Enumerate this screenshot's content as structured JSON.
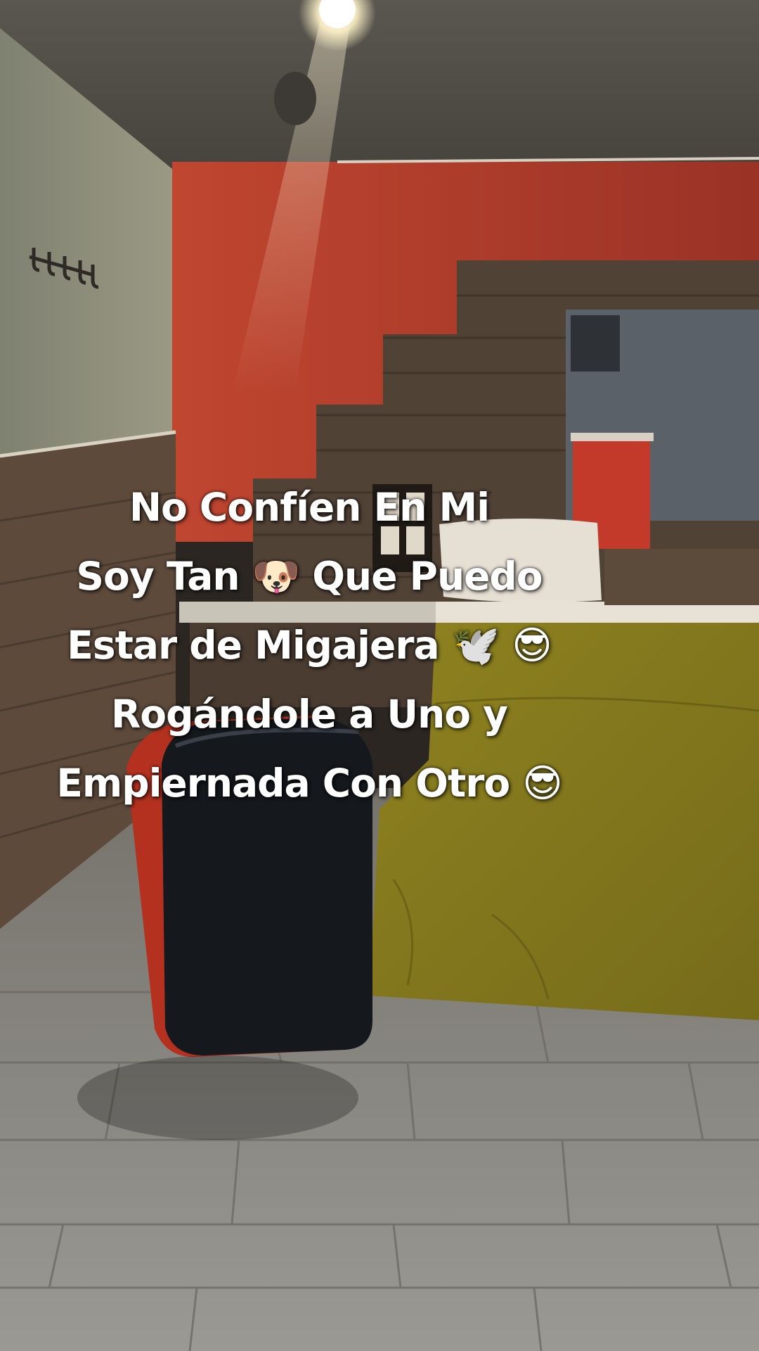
{
  "caption": {
    "lines": [
      "No Confíen En Mi",
      "Soy Tan 🐶 Que Puedo",
      "Estar de Migajera 🕊️ 😎",
      "Rogándole a Uno y",
      "Empiernada Con Otro 😎"
    ]
  },
  "scene": {
    "description_icons": [
      "ceiling-lamp",
      "coat-hook-rack",
      "window",
      "pillow",
      "bed",
      "red-black-chair",
      "wood-plank-wall",
      "tile-floor"
    ]
  },
  "colors": {
    "red_wall": "#b03a2c",
    "gray_wall": "#8b8c78",
    "bedspread": "#857a20",
    "floor": "#8f8f8b",
    "wood": "#4e4034"
  }
}
